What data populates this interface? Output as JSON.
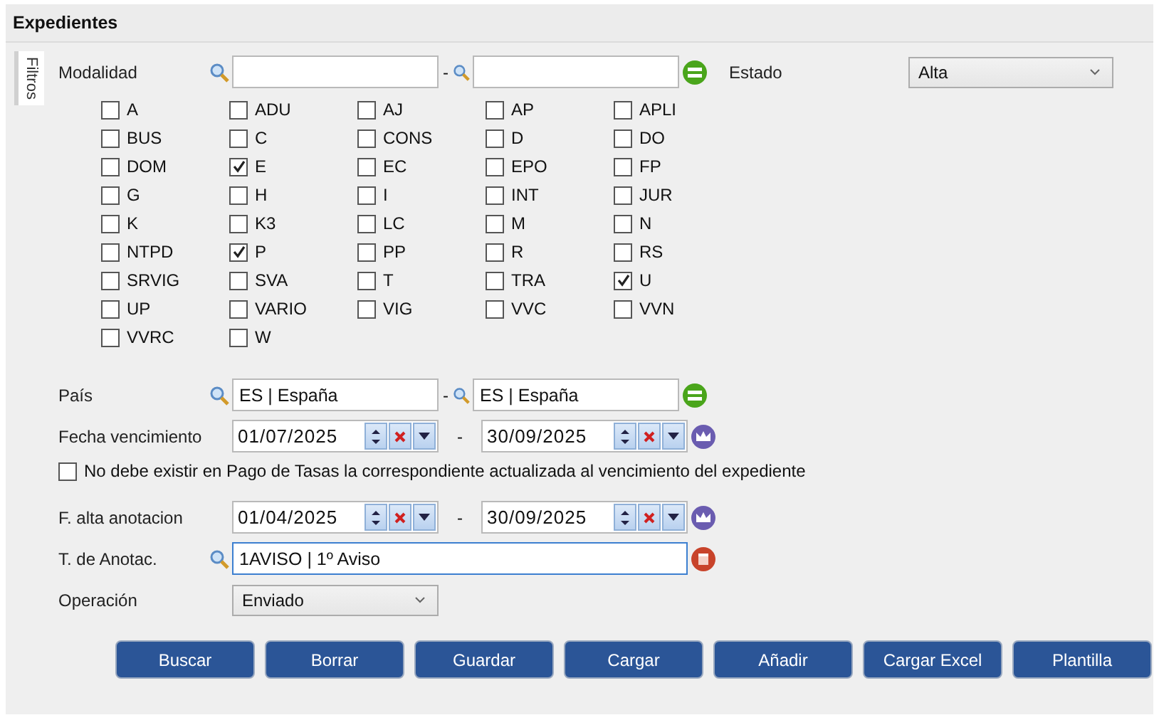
{
  "title": "Expedientes",
  "side_tab": "Filtros",
  "modalidad": {
    "label": "Modalidad",
    "separator": "-"
  },
  "estado": {
    "label": "Estado",
    "value": "Alta"
  },
  "checkboxes": [
    {
      "label": "A",
      "checked": false
    },
    {
      "label": "ADU",
      "checked": false
    },
    {
      "label": "AJ",
      "checked": false
    },
    {
      "label": "AP",
      "checked": false
    },
    {
      "label": "APLI",
      "checked": false
    },
    {
      "label": "BUS",
      "checked": false
    },
    {
      "label": "C",
      "checked": false
    },
    {
      "label": "CONS",
      "checked": false
    },
    {
      "label": "D",
      "checked": false
    },
    {
      "label": "DO",
      "checked": false
    },
    {
      "label": "DOM",
      "checked": false
    },
    {
      "label": "E",
      "checked": true
    },
    {
      "label": "EC",
      "checked": false
    },
    {
      "label": "EPO",
      "checked": false
    },
    {
      "label": "FP",
      "checked": false
    },
    {
      "label": "G",
      "checked": false
    },
    {
      "label": "H",
      "checked": false
    },
    {
      "label": "I",
      "checked": false
    },
    {
      "label": "INT",
      "checked": false
    },
    {
      "label": "JUR",
      "checked": false
    },
    {
      "label": "K",
      "checked": false
    },
    {
      "label": "K3",
      "checked": false
    },
    {
      "label": "LC",
      "checked": false
    },
    {
      "label": "M",
      "checked": false
    },
    {
      "label": "N",
      "checked": false
    },
    {
      "label": "NTPD",
      "checked": false
    },
    {
      "label": "P",
      "checked": true
    },
    {
      "label": "PP",
      "checked": false
    },
    {
      "label": "R",
      "checked": false
    },
    {
      "label": "RS",
      "checked": false
    },
    {
      "label": "SRVIG",
      "checked": false
    },
    {
      "label": "SVA",
      "checked": false
    },
    {
      "label": "T",
      "checked": false
    },
    {
      "label": "TRA",
      "checked": false
    },
    {
      "label": "U",
      "checked": true
    },
    {
      "label": "UP",
      "checked": false
    },
    {
      "label": "VARIO",
      "checked": false
    },
    {
      "label": "VIG",
      "checked": false
    },
    {
      "label": "VVC",
      "checked": false
    },
    {
      "label": "VVN",
      "checked": false
    },
    {
      "label": "VVRC",
      "checked": false
    },
    {
      "label": "W",
      "checked": false
    }
  ],
  "pais": {
    "label": "País",
    "from": "ES | España",
    "separator": "-",
    "to": "ES | España"
  },
  "fecha_vencimiento": {
    "label": "Fecha vencimiento",
    "from": "01/07/2025",
    "separator": "-",
    "to": "30/09/2025"
  },
  "tasas_option": {
    "label": "No debe existir en Pago de Tasas la correspondiente actualizada al vencimiento del expediente",
    "checked": false
  },
  "fecha_alta": {
    "label": "F. alta anotacion",
    "from": "01/04/2025",
    "separator": "-",
    "to": "30/09/2025"
  },
  "tipo_anotacion": {
    "label": "T. de Anotac.",
    "value": "1AVISO | 1º Aviso"
  },
  "operacion": {
    "label": "Operación",
    "value": "Enviado"
  },
  "buttons": [
    "Buscar",
    "Borrar",
    "Guardar",
    "Cargar",
    "Añadir",
    "Cargar Excel",
    "Plantilla"
  ]
}
